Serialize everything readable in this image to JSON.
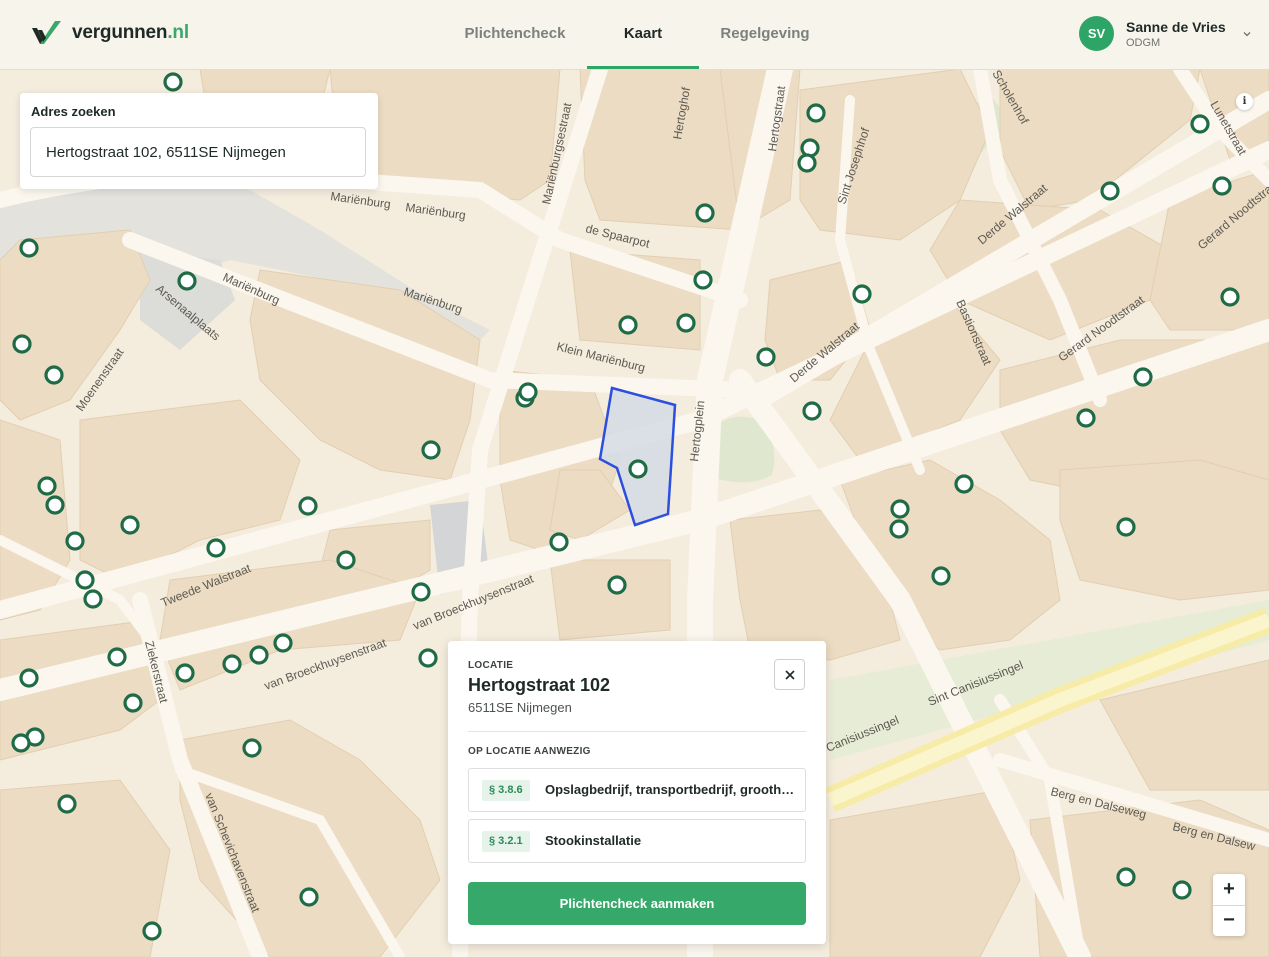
{
  "header": {
    "brand_name": "vergunnen",
    "brand_tld": ".nl",
    "tabs": [
      {
        "label": "Plichtencheck",
        "active": false
      },
      {
        "label": "Kaart",
        "active": true
      },
      {
        "label": "Regelgeving",
        "active": false
      }
    ],
    "user": {
      "initials": "SV",
      "name": "Sanne de Vries",
      "org": "ODGM",
      "menu_icon": "chevron-down-icon"
    }
  },
  "search": {
    "label": "Adres zoeken",
    "value": "Hertogstraat 102, 6511SE Nijmegen"
  },
  "location_card": {
    "kicker": "LOCATIE",
    "title": "Hertogstraat 102",
    "subtitle": "6511SE Nijmegen",
    "close_icon": "close-icon",
    "present_label": "OP LOCATIE AANWEZIG",
    "items": [
      {
        "paragraph": "§ 3.8.6",
        "label": "Opslagbedrijf, transportbedrijf, groothandel"
      },
      {
        "paragraph": "§ 3.2.1",
        "label": "Stookinstallatie"
      }
    ],
    "cta_label": "Plichtencheck aanmaken"
  },
  "map": {
    "zoom_in": "+",
    "zoom_out": "−",
    "info": "i",
    "street_labels": [
      "Mariënburg",
      "Mariënburg",
      "de Spaarpot",
      "Mariënburg",
      "Mariënburg",
      "Arsenaalplaats",
      "Moenenstraat",
      "Klein Mariënburg",
      "Hertogplein",
      "Hertogstraat",
      "Derde Walstraat",
      "Derde Walstraat",
      "Bastionstraat",
      "Gerard Noodtstraat",
      "Gerard Noodtstraat",
      "Lunetstraat",
      "Scholenhof",
      "Sint Josephhof",
      "Hertoghof",
      "Mariënburgsestraat",
      "Tweede Walstraat",
      "van Broeckhuysenstraat",
      "van Broeckhuysenstraat",
      "Ziekerstraat",
      "van Schevichavenstraat",
      "Sint Canisiussingel",
      "Canisiussingel",
      "Berg en Dalseweg",
      "Berg en Dalsew"
    ],
    "colors": {
      "background": "#f4ecdd",
      "block": "#ecdcc3",
      "road": "#fbf7ef",
      "parcel_fill": "#d6dde4",
      "parcel_stroke": "#2d4fe0",
      "marker": "#1e6b46",
      "accent": "#36a869"
    }
  }
}
